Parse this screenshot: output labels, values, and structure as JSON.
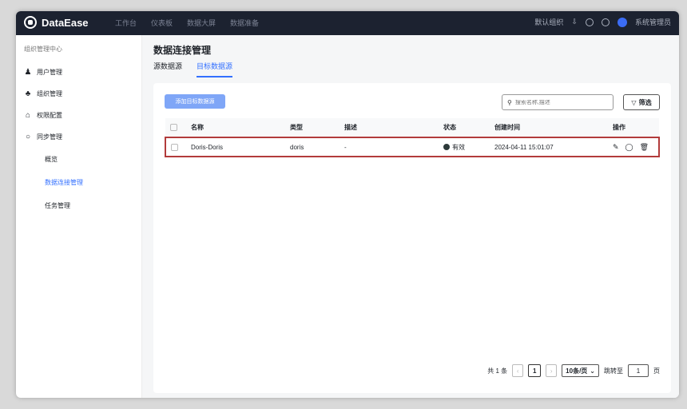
{
  "app": {
    "name": "DataEase"
  },
  "topnav": [
    "工作台",
    "仪表板",
    "数据大屏",
    "数据准备"
  ],
  "topright": {
    "org": "默认组织",
    "user": "系统管理员"
  },
  "sidebar": {
    "title": "组织管理中心",
    "items": [
      {
        "icon": "user-icon",
        "label": "用户管理"
      },
      {
        "icon": "org-icon",
        "label": "组织管理"
      },
      {
        "icon": "permission-icon",
        "label": "权限配置"
      },
      {
        "icon": "sync-icon",
        "label": "同步管理"
      }
    ],
    "subitems": [
      {
        "label": "概览"
      },
      {
        "label": "数据连接管理"
      },
      {
        "label": "任务管理"
      }
    ]
  },
  "main": {
    "title": "数据连接管理",
    "tabs": [
      {
        "label": "源数据源"
      },
      {
        "label": "目标数据源"
      }
    ],
    "add_button": "添加目标数据源",
    "search_placeholder": "搜索名称,描述",
    "filter_label": "筛选"
  },
  "table": {
    "columns": [
      "名称",
      "类型",
      "描述",
      "状态",
      "创建时间",
      "操作"
    ],
    "rows": [
      {
        "name": "Doris-Doris",
        "type": "doris",
        "desc": "-",
        "status": "有效",
        "created": "2024-04-11 15:01:07"
      }
    ]
  },
  "pager": {
    "total": "共 1 条",
    "current": "1",
    "page_size": "10条/页",
    "jump_label": "跳转至",
    "jump_value": "1",
    "page_unit": "页"
  },
  "colors": {
    "accent": "#3370ff",
    "topbar": "#1c2230",
    "highlight": "#b23b3b"
  }
}
